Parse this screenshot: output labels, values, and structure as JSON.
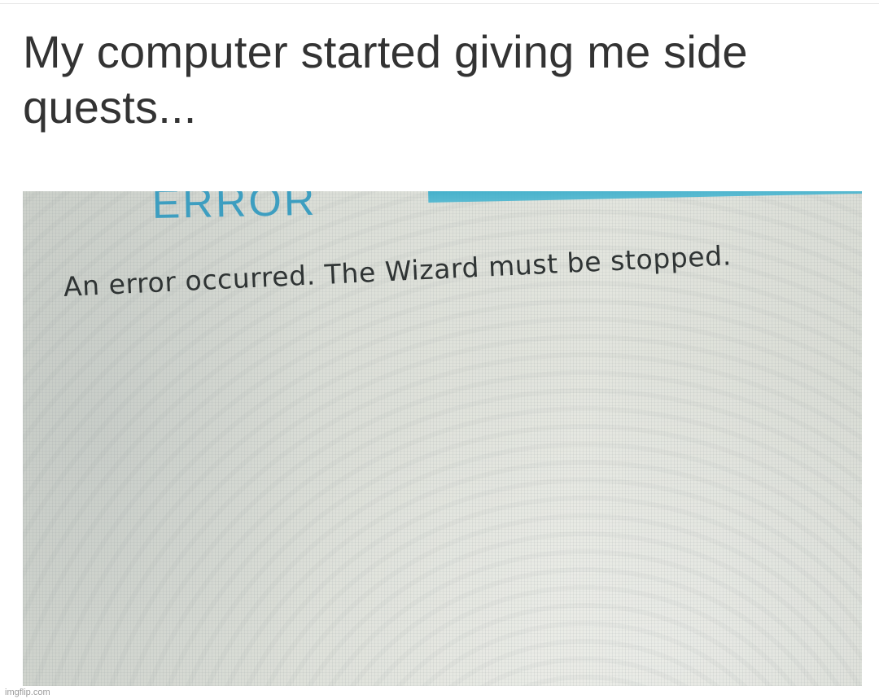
{
  "post": {
    "caption": "My computer started giving me side quests..."
  },
  "dialog": {
    "title": "ERROR",
    "message": "An error occurred. The Wizard must be stopped.",
    "title_color": "#3d9ec0",
    "accent_bar_color": "#2fa9c8"
  },
  "watermark": {
    "text": "imgflip.com"
  }
}
